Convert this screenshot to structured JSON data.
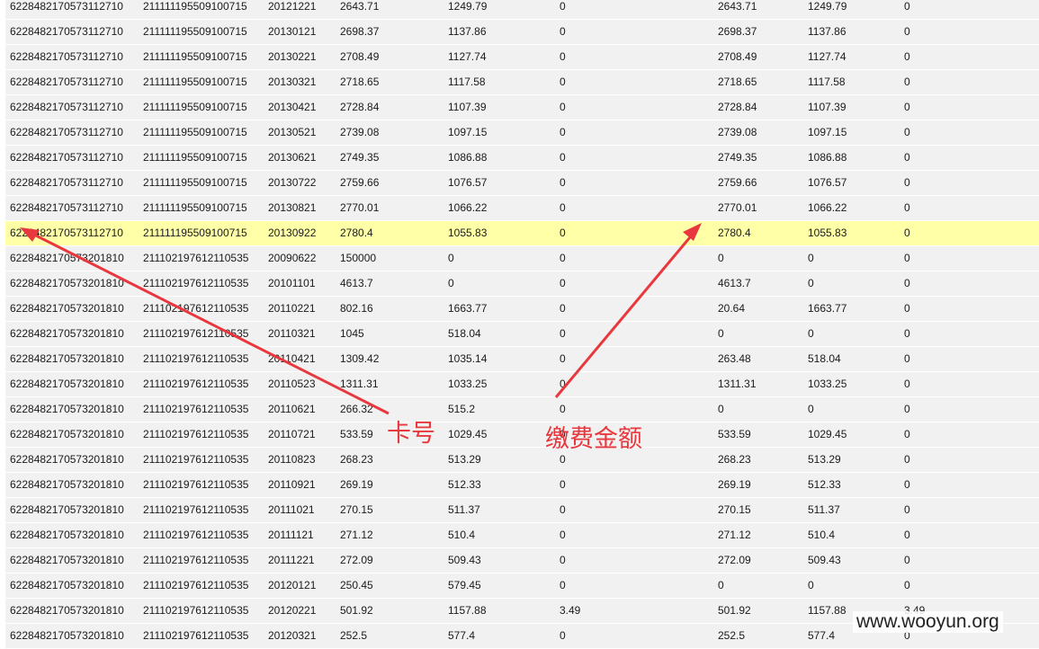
{
  "rows": [
    {
      "c": [
        "6228482170573112710",
        "211111195509100715",
        "20121221",
        "2643.71",
        "1249.79",
        "0",
        "2643.71",
        "1249.79",
        "0"
      ]
    },
    {
      "c": [
        "6228482170573112710",
        "211111195509100715",
        "20130121",
        "2698.37",
        "1137.86",
        "0",
        "2698.37",
        "1137.86",
        "0"
      ]
    },
    {
      "c": [
        "6228482170573112710",
        "211111195509100715",
        "20130221",
        "2708.49",
        "1127.74",
        "0",
        "2708.49",
        "1127.74",
        "0"
      ]
    },
    {
      "c": [
        "6228482170573112710",
        "211111195509100715",
        "20130321",
        "2718.65",
        "1117.58",
        "0",
        "2718.65",
        "1117.58",
        "0"
      ]
    },
    {
      "c": [
        "6228482170573112710",
        "211111195509100715",
        "20130421",
        "2728.84",
        "1107.39",
        "0",
        "2728.84",
        "1107.39",
        "0"
      ]
    },
    {
      "c": [
        "6228482170573112710",
        "211111195509100715",
        "20130521",
        "2739.08",
        "1097.15",
        "0",
        "2739.08",
        "1097.15",
        "0"
      ]
    },
    {
      "c": [
        "6228482170573112710",
        "211111195509100715",
        "20130621",
        "2749.35",
        "1086.88",
        "0",
        "2749.35",
        "1086.88",
        "0"
      ]
    },
    {
      "c": [
        "6228482170573112710",
        "211111195509100715",
        "20130722",
        "2759.66",
        "1076.57",
        "0",
        "2759.66",
        "1076.57",
        "0"
      ]
    },
    {
      "c": [
        "6228482170573112710",
        "211111195509100715",
        "20130821",
        "2770.01",
        "1066.22",
        "0",
        "2770.01",
        "1066.22",
        "0"
      ]
    },
    {
      "c": [
        "6228482170573112710",
        "211111195509100715",
        "20130922",
        "2780.4",
        "1055.83",
        "0",
        "2780.4",
        "1055.83",
        "0"
      ],
      "highlight": true
    },
    {
      "c": [
        "6228482170573201810",
        "211102197612110535",
        "20090622",
        "150000",
        "0",
        "0",
        "0",
        "0",
        "0"
      ]
    },
    {
      "c": [
        "6228482170573201810",
        "211102197612110535",
        "20101101",
        "4613.7",
        "0",
        "0",
        "4613.7",
        "0",
        "0"
      ]
    },
    {
      "c": [
        "6228482170573201810",
        "211102197612110535",
        "20110221",
        "802.16",
        "1663.77",
        "0",
        "20.64",
        "1663.77",
        "0"
      ]
    },
    {
      "c": [
        "6228482170573201810",
        "211102197612110535",
        "20110321",
        "1045",
        "518.04",
        "0",
        "0",
        "0",
        "0"
      ]
    },
    {
      "c": [
        "6228482170573201810",
        "211102197612110535",
        "20110421",
        "1309.42",
        "1035.14",
        "0",
        "263.48",
        "518.04",
        "0"
      ]
    },
    {
      "c": [
        "6228482170573201810",
        "211102197612110535",
        "20110523",
        "1311.31",
        "1033.25",
        "0",
        "1311.31",
        "1033.25",
        "0"
      ]
    },
    {
      "c": [
        "6228482170573201810",
        "211102197612110535",
        "20110621",
        "266.32",
        "515.2",
        "0",
        "0",
        "0",
        "0"
      ]
    },
    {
      "c": [
        "6228482170573201810",
        "211102197612110535",
        "20110721",
        "533.59",
        "1029.45",
        "0",
        "533.59",
        "1029.45",
        "0"
      ]
    },
    {
      "c": [
        "6228482170573201810",
        "211102197612110535",
        "20110823",
        "268.23",
        "513.29",
        "0",
        "268.23",
        "513.29",
        "0"
      ]
    },
    {
      "c": [
        "6228482170573201810",
        "211102197612110535",
        "20110921",
        "269.19",
        "512.33",
        "0",
        "269.19",
        "512.33",
        "0"
      ]
    },
    {
      "c": [
        "6228482170573201810",
        "211102197612110535",
        "20111021",
        "270.15",
        "511.37",
        "0",
        "270.15",
        "511.37",
        "0"
      ]
    },
    {
      "c": [
        "6228482170573201810",
        "211102197612110535",
        "20111121",
        "271.12",
        "510.4",
        "0",
        "271.12",
        "510.4",
        "0"
      ]
    },
    {
      "c": [
        "6228482170573201810",
        "211102197612110535",
        "20111221",
        "272.09",
        "509.43",
        "0",
        "272.09",
        "509.43",
        "0"
      ]
    },
    {
      "c": [
        "6228482170573201810",
        "211102197612110535",
        "20120121",
        "250.45",
        "579.45",
        "0",
        "0",
        "0",
        "0"
      ]
    },
    {
      "c": [
        "6228482170573201810",
        "211102197612110535",
        "20120221",
        "501.92",
        "1157.88",
        "3.49",
        "501.92",
        "1157.88",
        "3.49"
      ]
    },
    {
      "c": [
        "6228482170573201810",
        "211102197612110535",
        "20120321",
        "252.5",
        "577.4",
        "0",
        "252.5",
        "577.4",
        "0"
      ]
    }
  ],
  "annotations": {
    "card_label": "卡号",
    "fee_label": "缴费金额",
    "color": "#e8383d"
  },
  "watermark": "www.wooyun.org",
  "colors": {
    "row_bg": "#f1f1f1",
    "highlight_bg": "#ffffa8"
  }
}
